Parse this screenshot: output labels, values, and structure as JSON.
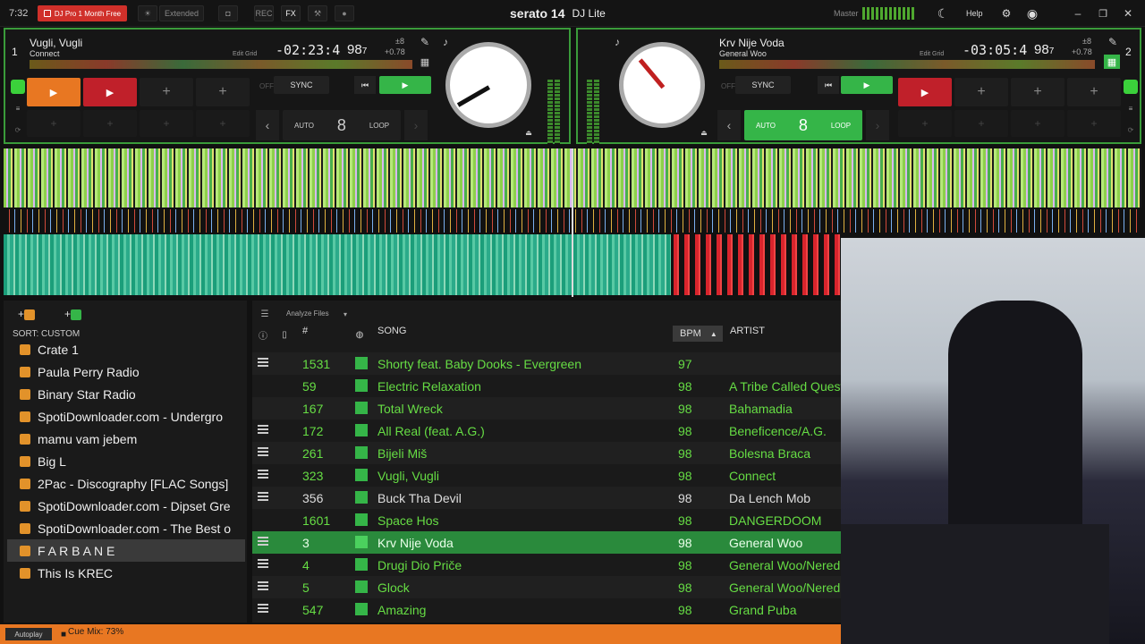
{
  "topbar": {
    "clock": "7:32",
    "promo": "DJ Pro 1 Month Free",
    "extended": "Extended",
    "rec": "REC",
    "fx": "FX",
    "brand_main": "serato 14",
    "brand_sub": "DJ Lite",
    "master": "Master",
    "help": "Help"
  },
  "deck1": {
    "num": "1",
    "title": "Vugli, Vugli",
    "artist": "Connect",
    "time": "-02:23:4",
    "bpm": "98",
    "bpm_decimal": "7",
    "pitch_range": "±8",
    "pitch": "+0.78",
    "edit_grid": "Edit Grid",
    "sync": "SYNC",
    "off": "OFF",
    "auto": "AUTO",
    "loop_len": "8",
    "loop": "LOOP"
  },
  "deck2": {
    "num": "2",
    "title": "Krv Nije Voda",
    "artist": "General Woo",
    "time": "-03:05:4",
    "bpm": "98",
    "bpm_decimal": "7",
    "pitch_range": "±8",
    "pitch": "+0.78",
    "edit_grid": "Edit Grid",
    "sync": "SYNC",
    "off": "OFF",
    "auto": "AUTO",
    "loop_len": "8",
    "loop": "LOOP"
  },
  "sidebar": {
    "sort_label": "SORT: CUSTOM",
    "crates": [
      "Crate 1",
      "Paula Perry Radio",
      "Binary Star Radio",
      "SpotiDownloader.com - Undergro",
      "mamu vam jebem",
      "Big L",
      "2Pac - Discography [FLAC Songs]",
      "SpotiDownloader.com - Dipset Gre",
      "SpotiDownloader.com - The Best o",
      "F A R B A N E",
      "This Is KREC"
    ]
  },
  "library": {
    "analyze": "Analyze Files",
    "headers": {
      "num": "#",
      "song": "SONG",
      "bpm": "BPM",
      "artist": "ARTIST"
    },
    "rows": [
      {
        "num": "1531",
        "song": "Shorty feat. Baby Dooks - Evergreen",
        "bpm": "97",
        "artist": ""
      },
      {
        "num": "59",
        "song": "Electric Relaxation",
        "bpm": "98",
        "artist": "A Tribe Called Quest"
      },
      {
        "num": "167",
        "song": "Total Wreck",
        "bpm": "98",
        "artist": "Bahamadia"
      },
      {
        "num": "172",
        "song": "All Real (feat. A.G.)",
        "bpm": "98",
        "artist": "Beneficence/A.G."
      },
      {
        "num": "261",
        "song": "Bijeli Miš",
        "bpm": "98",
        "artist": "Bolesna Braca"
      },
      {
        "num": "323",
        "song": "Vugli, Vugli",
        "bpm": "98",
        "artist": "Connect"
      },
      {
        "num": "356",
        "song": "Buck Tha Devil",
        "bpm": "98",
        "artist": "Da Lench Mob"
      },
      {
        "num": "1601",
        "song": "Space Hos",
        "bpm": "98",
        "artist": "DANGERDOOM"
      },
      {
        "num": "3",
        "song": "Krv Nije Voda",
        "bpm": "98",
        "artist": "General Woo"
      },
      {
        "num": "4",
        "song": "Drugi Dio Priče",
        "bpm": "98",
        "artist": "General Woo/Nered"
      },
      {
        "num": "5",
        "song": "Glock",
        "bpm": "98",
        "artist": "General Woo/Nered"
      },
      {
        "num": "547",
        "song": "Amazing",
        "bpm": "98",
        "artist": "Grand Puba"
      }
    ]
  },
  "footer": {
    "autoplay": "Autoplay",
    "cue_mix": "Cue Mix: 73%"
  }
}
